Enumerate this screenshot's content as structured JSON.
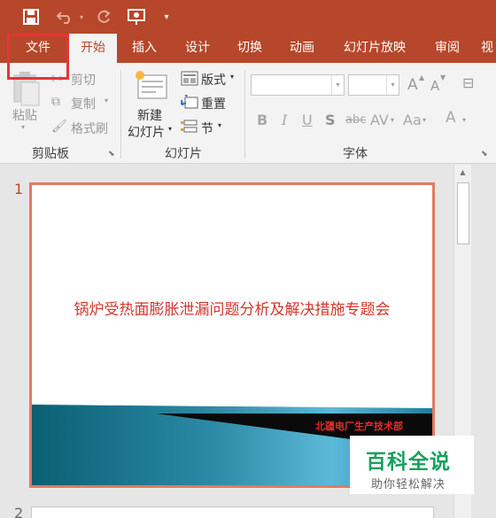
{
  "qat": {
    "save_icon": "save-icon",
    "undo_icon": "undo-icon",
    "redo_icon": "redo-icon",
    "present_icon": "present-from-start-icon",
    "customize_icon": "customize-dropdown-icon"
  },
  "tabs": [
    {
      "label": "文件"
    },
    {
      "label": "开始"
    },
    {
      "label": "插入"
    },
    {
      "label": "设计"
    },
    {
      "label": "切换"
    },
    {
      "label": "动画"
    },
    {
      "label": "幻灯片放映"
    },
    {
      "label": "审阅"
    },
    {
      "label": "视"
    }
  ],
  "ribbon": {
    "clipboard": {
      "paste": "粘贴",
      "cut": "剪切",
      "copy": "复制",
      "format_painter": "格式刷",
      "group_label": "剪贴板"
    },
    "slides": {
      "new_slide_line1": "新建",
      "new_slide_line2": "幻灯片",
      "layout": "版式",
      "reset": "重置",
      "section": "节",
      "group_label": "幻灯片"
    },
    "font": {
      "group_label": "字体",
      "font_name": "",
      "font_size": "",
      "bold": "B",
      "italic": "I",
      "underline": "U",
      "shadow": "S",
      "strikethrough": "abc",
      "spacing": "AV",
      "change_case": "Aa",
      "color": "A",
      "grow": "A",
      "shrink": "A"
    }
  },
  "slides": [
    {
      "number": "1",
      "title": "锅炉受热面膨胀泄漏问题分析及解决措施专题会",
      "department": "北疆电厂生产技术部"
    },
    {
      "number": "2"
    }
  ],
  "watermark": {
    "brand": "百科全说",
    "tagline": "助你轻松解决"
  },
  "colors": {
    "accent": "#b7472a",
    "highlight_box": "#e8333a",
    "slide_title": "#d3372e",
    "watermark_green": "#18a05e"
  }
}
